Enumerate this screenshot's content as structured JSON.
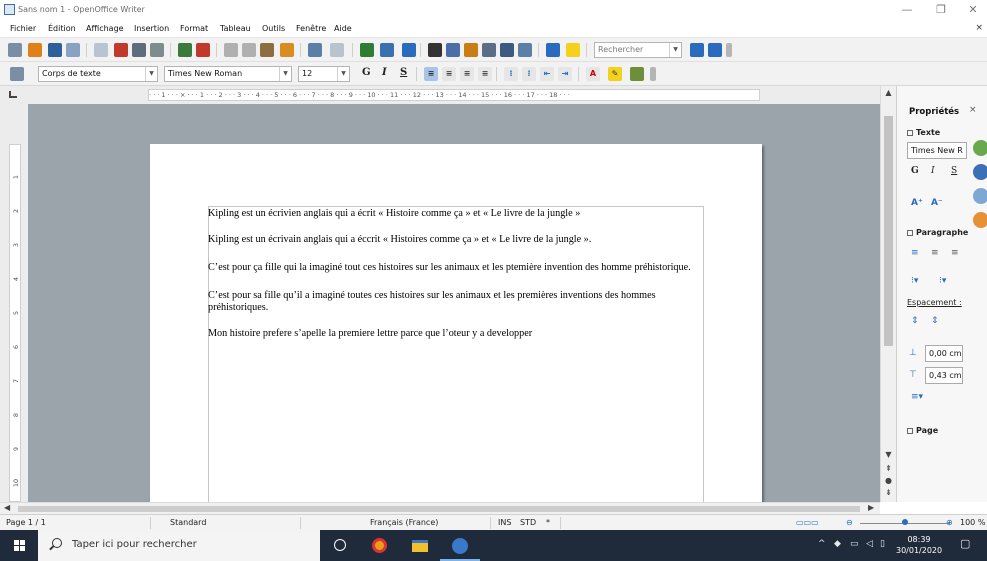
{
  "window": {
    "title": "Sans nom 1 - OpenOffice Writer",
    "minimize": "—",
    "maximize": "❐",
    "close": "✕"
  },
  "menu": {
    "items": [
      "Fichier",
      "Édition",
      "Affichage",
      "Insertion",
      "Format",
      "Tableau",
      "Outils",
      "Fenêtre",
      "Aide"
    ],
    "close_doc": "×"
  },
  "toolbar_standard": {
    "search_placeholder": "Rechercher"
  },
  "toolbar_format": {
    "paragraph_style": "Corps de texte",
    "font_name": "Times New Roman",
    "font_size": "12",
    "bold": "G",
    "italic": "I",
    "underline": "S"
  },
  "ruler": {
    "horizontal": "· · · 1 · · · ⨯ · · · 1 · · · 2 · · · 3 · · · 4 · · · 5 · · · 6 · · · 7 · · · 8 · · · 9 · · · 10 · · · 11 · · · 12 · · · 13 · · · 14 · · · 15 · · · 16 · · · 17 · · · 18 · · ·",
    "vertical": [
      "1",
      "2",
      "3",
      "4",
      "5",
      "6",
      "7",
      "8",
      "9",
      "10"
    ]
  },
  "document": {
    "paragraphs": [
      "Kipling est un écrivien anglais qui a écrit « Histoire comme ça » et « Le livre de la jungle »",
      "Kipling est un écrivain anglais qui a éccrit « Histoires comme ça » et « Le livre de la jungle ».",
      "C’est pour ça fille qui la imaginé tout ces histoires sur les animaux et les ptemière invention des homme préhistorique.",
      "C’est pour sa fille qu’il a imaginé toutes ces histoires sur les animaux et les premières inventions des hommes préhistoriques.",
      "Mon histoire prefere s’apelle la premiere lettre parce que l’oteur y a developper"
    ]
  },
  "sidebar": {
    "title": "Propriétés",
    "close": "×",
    "text_section": "Texte",
    "font_name": "Times New R",
    "bold": "G",
    "italic": "I",
    "underline": "S",
    "paragraph_section": "Paragraphe",
    "spacing_label": "Espacement :",
    "indent_before": "0,00 cm",
    "indent_after": "0,43 cm",
    "page_section": "Page"
  },
  "status": {
    "page": "Page 1 / 1",
    "style": "Standard",
    "language": "Français (France)",
    "insert_mode": "INS",
    "selection_mode": "STD",
    "modified": "*",
    "zoom": "100 %"
  },
  "taskbar": {
    "search_placeholder": "Taper ici pour rechercher",
    "time": "08:39",
    "date": "30/01/2020"
  },
  "colors": {
    "doc_background": "#9ba3ab",
    "taskbar": "#1f2a3b",
    "accent_blue": "#2a6bbf",
    "highlight_yellow": "#f4d11c"
  }
}
